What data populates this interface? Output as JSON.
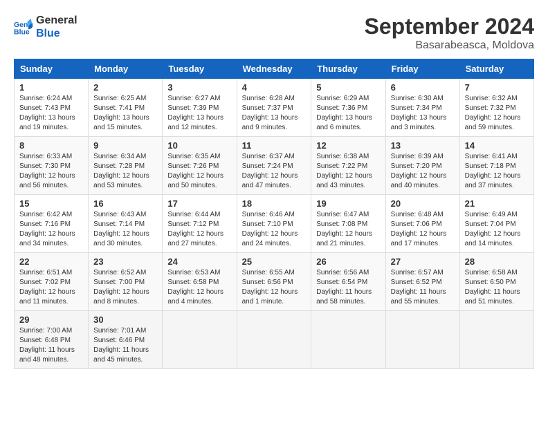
{
  "header": {
    "logo_text_general": "General",
    "logo_text_blue": "Blue",
    "month_year": "September 2024",
    "location": "Basarabeasca, Moldova"
  },
  "weekdays": [
    "Sunday",
    "Monday",
    "Tuesday",
    "Wednesday",
    "Thursday",
    "Friday",
    "Saturday"
  ],
  "weeks": [
    [
      {
        "day": "1",
        "sunrise": "Sunrise: 6:24 AM",
        "sunset": "Sunset: 7:43 PM",
        "daylight": "Daylight: 13 hours and 19 minutes."
      },
      {
        "day": "2",
        "sunrise": "Sunrise: 6:25 AM",
        "sunset": "Sunset: 7:41 PM",
        "daylight": "Daylight: 13 hours and 15 minutes."
      },
      {
        "day": "3",
        "sunrise": "Sunrise: 6:27 AM",
        "sunset": "Sunset: 7:39 PM",
        "daylight": "Daylight: 13 hours and 12 minutes."
      },
      {
        "day": "4",
        "sunrise": "Sunrise: 6:28 AM",
        "sunset": "Sunset: 7:37 PM",
        "daylight": "Daylight: 13 hours and 9 minutes."
      },
      {
        "day": "5",
        "sunrise": "Sunrise: 6:29 AM",
        "sunset": "Sunset: 7:36 PM",
        "daylight": "Daylight: 13 hours and 6 minutes."
      },
      {
        "day": "6",
        "sunrise": "Sunrise: 6:30 AM",
        "sunset": "Sunset: 7:34 PM",
        "daylight": "Daylight: 13 hours and 3 minutes."
      },
      {
        "day": "7",
        "sunrise": "Sunrise: 6:32 AM",
        "sunset": "Sunset: 7:32 PM",
        "daylight": "Daylight: 12 hours and 59 minutes."
      }
    ],
    [
      {
        "day": "8",
        "sunrise": "Sunrise: 6:33 AM",
        "sunset": "Sunset: 7:30 PM",
        "daylight": "Daylight: 12 hours and 56 minutes."
      },
      {
        "day": "9",
        "sunrise": "Sunrise: 6:34 AM",
        "sunset": "Sunset: 7:28 PM",
        "daylight": "Daylight: 12 hours and 53 minutes."
      },
      {
        "day": "10",
        "sunrise": "Sunrise: 6:35 AM",
        "sunset": "Sunset: 7:26 PM",
        "daylight": "Daylight: 12 hours and 50 minutes."
      },
      {
        "day": "11",
        "sunrise": "Sunrise: 6:37 AM",
        "sunset": "Sunset: 7:24 PM",
        "daylight": "Daylight: 12 hours and 47 minutes."
      },
      {
        "day": "12",
        "sunrise": "Sunrise: 6:38 AM",
        "sunset": "Sunset: 7:22 PM",
        "daylight": "Daylight: 12 hours and 43 minutes."
      },
      {
        "day": "13",
        "sunrise": "Sunrise: 6:39 AM",
        "sunset": "Sunset: 7:20 PM",
        "daylight": "Daylight: 12 hours and 40 minutes."
      },
      {
        "day": "14",
        "sunrise": "Sunrise: 6:41 AM",
        "sunset": "Sunset: 7:18 PM",
        "daylight": "Daylight: 12 hours and 37 minutes."
      }
    ],
    [
      {
        "day": "15",
        "sunrise": "Sunrise: 6:42 AM",
        "sunset": "Sunset: 7:16 PM",
        "daylight": "Daylight: 12 hours and 34 minutes."
      },
      {
        "day": "16",
        "sunrise": "Sunrise: 6:43 AM",
        "sunset": "Sunset: 7:14 PM",
        "daylight": "Daylight: 12 hours and 30 minutes."
      },
      {
        "day": "17",
        "sunrise": "Sunrise: 6:44 AM",
        "sunset": "Sunset: 7:12 PM",
        "daylight": "Daylight: 12 hours and 27 minutes."
      },
      {
        "day": "18",
        "sunrise": "Sunrise: 6:46 AM",
        "sunset": "Sunset: 7:10 PM",
        "daylight": "Daylight: 12 hours and 24 minutes."
      },
      {
        "day": "19",
        "sunrise": "Sunrise: 6:47 AM",
        "sunset": "Sunset: 7:08 PM",
        "daylight": "Daylight: 12 hours and 21 minutes."
      },
      {
        "day": "20",
        "sunrise": "Sunrise: 6:48 AM",
        "sunset": "Sunset: 7:06 PM",
        "daylight": "Daylight: 12 hours and 17 minutes."
      },
      {
        "day": "21",
        "sunrise": "Sunrise: 6:49 AM",
        "sunset": "Sunset: 7:04 PM",
        "daylight": "Daylight: 12 hours and 14 minutes."
      }
    ],
    [
      {
        "day": "22",
        "sunrise": "Sunrise: 6:51 AM",
        "sunset": "Sunset: 7:02 PM",
        "daylight": "Daylight: 12 hours and 11 minutes."
      },
      {
        "day": "23",
        "sunrise": "Sunrise: 6:52 AM",
        "sunset": "Sunset: 7:00 PM",
        "daylight": "Daylight: 12 hours and 8 minutes."
      },
      {
        "day": "24",
        "sunrise": "Sunrise: 6:53 AM",
        "sunset": "Sunset: 6:58 PM",
        "daylight": "Daylight: 12 hours and 4 minutes."
      },
      {
        "day": "25",
        "sunrise": "Sunrise: 6:55 AM",
        "sunset": "Sunset: 6:56 PM",
        "daylight": "Daylight: 12 hours and 1 minute."
      },
      {
        "day": "26",
        "sunrise": "Sunrise: 6:56 AM",
        "sunset": "Sunset: 6:54 PM",
        "daylight": "Daylight: 11 hours and 58 minutes."
      },
      {
        "day": "27",
        "sunrise": "Sunrise: 6:57 AM",
        "sunset": "Sunset: 6:52 PM",
        "daylight": "Daylight: 11 hours and 55 minutes."
      },
      {
        "day": "28",
        "sunrise": "Sunrise: 6:58 AM",
        "sunset": "Sunset: 6:50 PM",
        "daylight": "Daylight: 11 hours and 51 minutes."
      }
    ],
    [
      {
        "day": "29",
        "sunrise": "Sunrise: 7:00 AM",
        "sunset": "Sunset: 6:48 PM",
        "daylight": "Daylight: 11 hours and 48 minutes."
      },
      {
        "day": "30",
        "sunrise": "Sunrise: 7:01 AM",
        "sunset": "Sunset: 6:46 PM",
        "daylight": "Daylight: 11 hours and 45 minutes."
      },
      {
        "day": "",
        "sunrise": "",
        "sunset": "",
        "daylight": ""
      },
      {
        "day": "",
        "sunrise": "",
        "sunset": "",
        "daylight": ""
      },
      {
        "day": "",
        "sunrise": "",
        "sunset": "",
        "daylight": ""
      },
      {
        "day": "",
        "sunrise": "",
        "sunset": "",
        "daylight": ""
      },
      {
        "day": "",
        "sunrise": "",
        "sunset": "",
        "daylight": ""
      }
    ]
  ]
}
